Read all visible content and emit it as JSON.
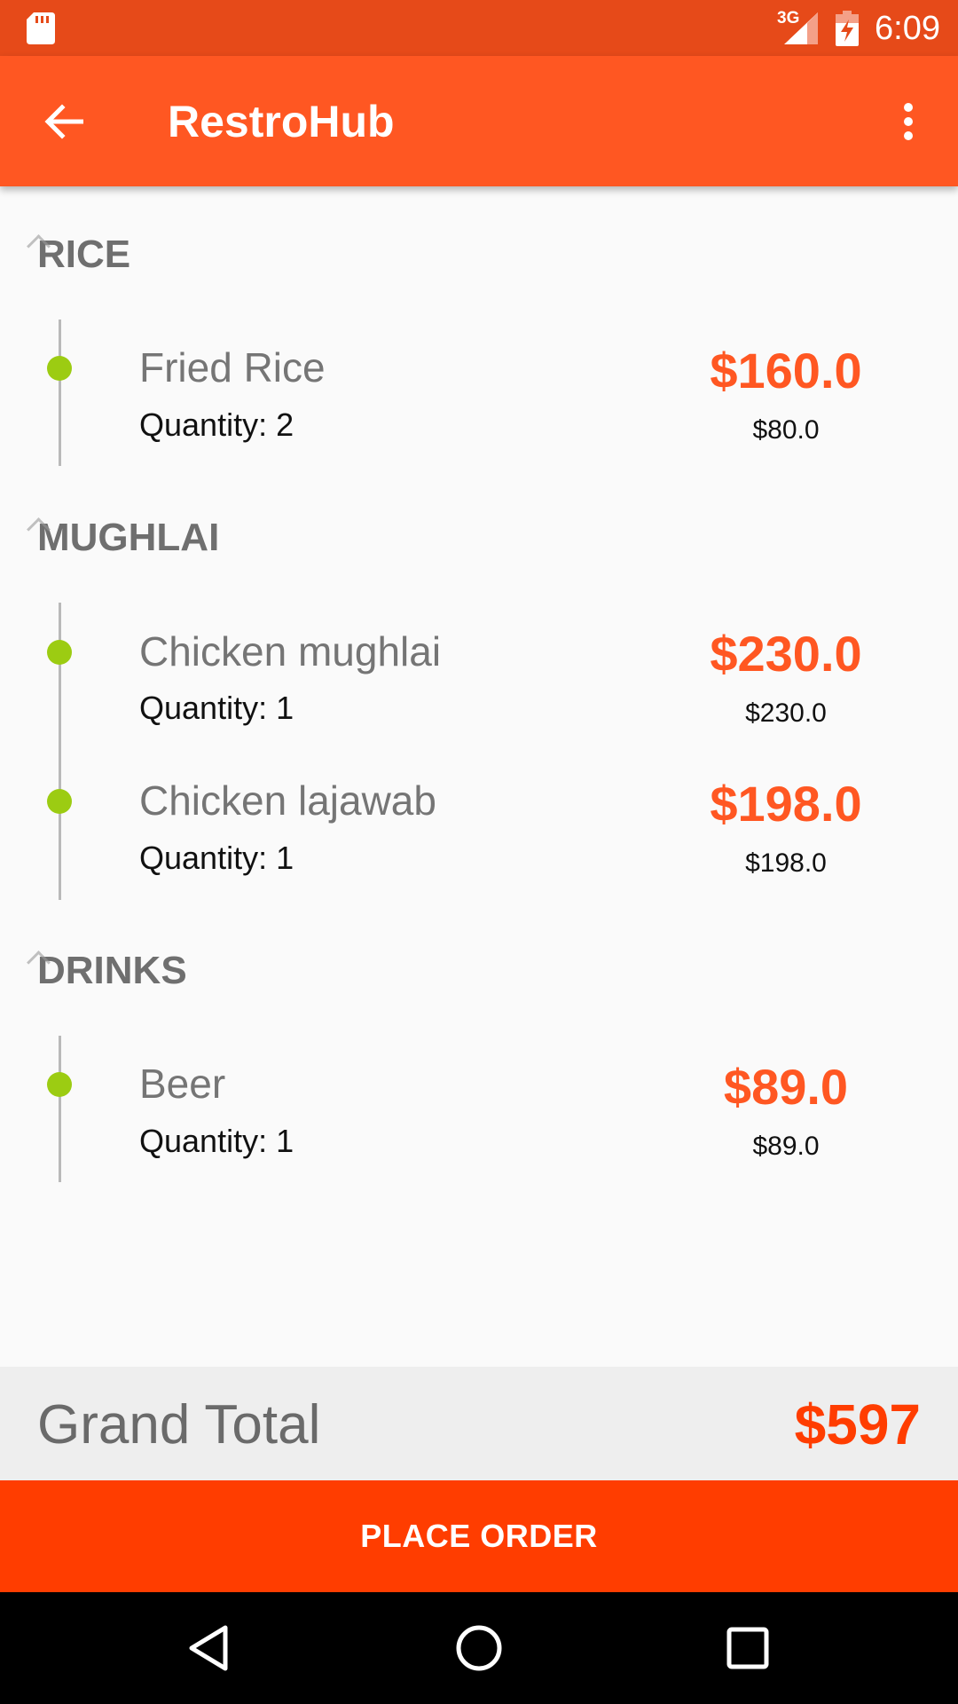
{
  "status_bar": {
    "network": "3G",
    "time": "6:09",
    "icons": [
      "sd-card-icon",
      "signal-icon",
      "battery-charging-icon"
    ]
  },
  "app_bar": {
    "title": "RestroHub",
    "icons": [
      "back-arrow-icon",
      "more-vert-icon"
    ]
  },
  "categories": [
    {
      "name": "RICE",
      "items": [
        {
          "name": "Fried Rice",
          "quantity": "Quantity: 2",
          "total": "$160.0",
          "unit_price": "$80.0"
        }
      ]
    },
    {
      "name": "MUGHLAI",
      "items": [
        {
          "name": "Chicken mughlai",
          "quantity": "Quantity: 1",
          "total": "$230.0",
          "unit_price": "$230.0"
        },
        {
          "name": "Chicken lajawab",
          "quantity": "Quantity: 1",
          "total": "$198.0",
          "unit_price": "$198.0"
        }
      ]
    },
    {
      "name": "DRINKS",
      "items": [
        {
          "name": "Beer",
          "quantity": "Quantity: 1",
          "total": "$89.0",
          "unit_price": "$89.0"
        }
      ]
    }
  ],
  "grand_total": {
    "label": "Grand Total",
    "value": "$597"
  },
  "place_order": {
    "label": "PLACE ORDER"
  },
  "nav_bar": {
    "icons": [
      "back-triangle-icon",
      "home-circle-icon",
      "recents-square-icon"
    ]
  },
  "colors": {
    "status_bar": "#e64a19",
    "app_bar": "#ff5722",
    "accent_price": "#ff5722",
    "grand_total": "#ff3d00",
    "place_order": "#ff3d00",
    "timeline_dot": "#9ccc12"
  }
}
